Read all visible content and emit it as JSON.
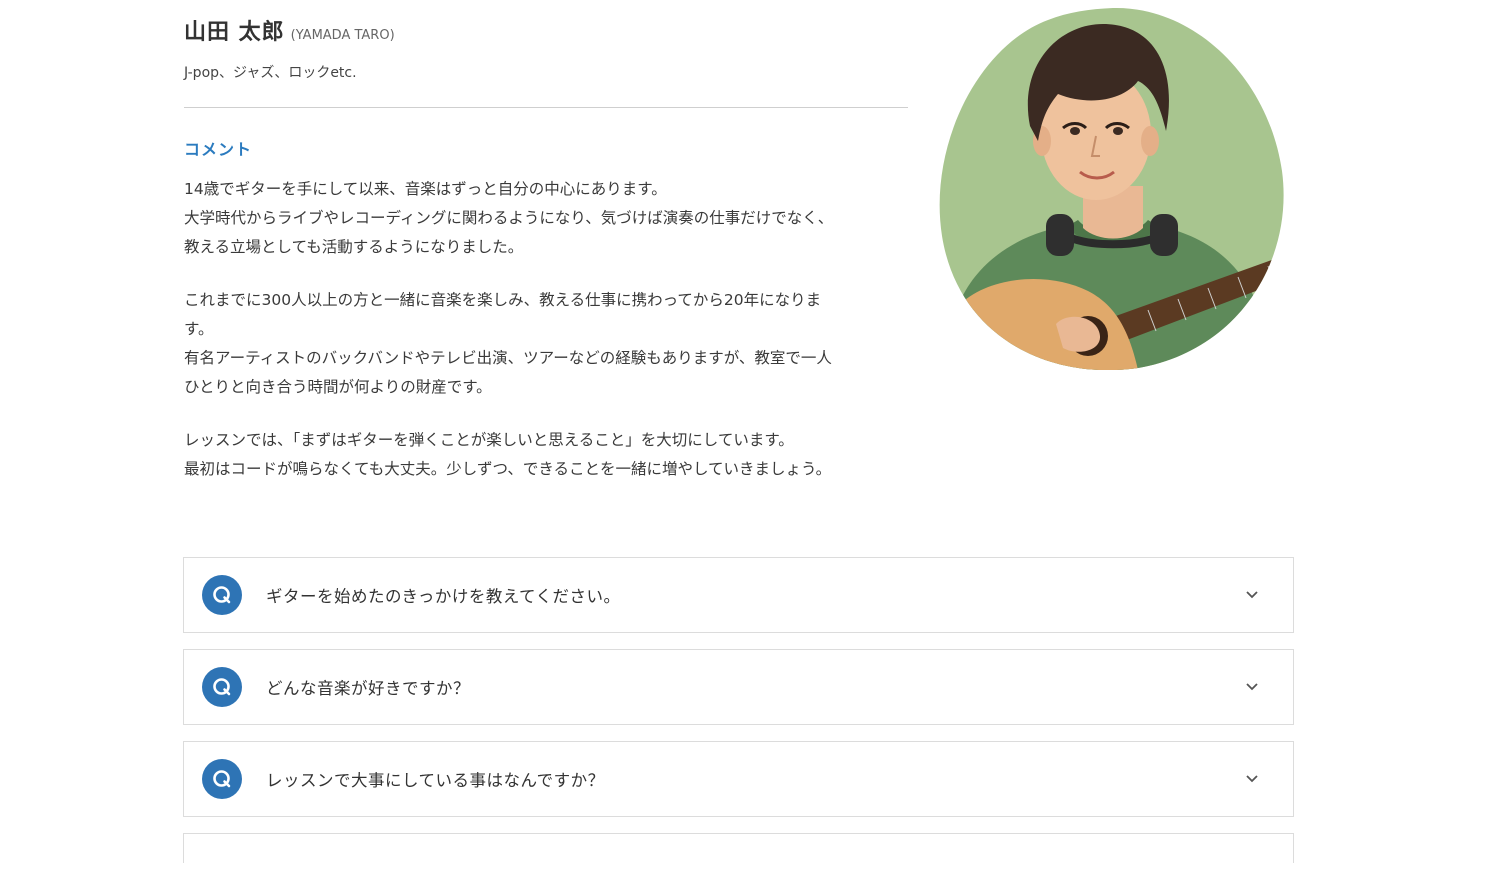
{
  "profile": {
    "name_jp": "山田 太郎",
    "name_en": "(YAMADA TARO)",
    "genres": "J-pop、ジャズ、ロックetc."
  },
  "comment": {
    "heading": "コメント",
    "paragraphs": [
      [
        "14歳でギターを手にして以来、音楽はずっと自分の中心にあります。",
        "大学時代からライブやレコーディングに関わるようになり、気づけば演奏の仕事だけでなく、",
        "教える立場としても活動するようになりました。"
      ],
      [
        "これまでに300人以上の方と一緒に音楽を楽しみ、教える仕事に携わってから20年になりま",
        "す。",
        "有名アーティストのバックバンドやテレビ出演、ツアーなどの経験もありますが、教室で一人",
        "ひとりと向き合う時間が何よりの財産です。"
      ],
      [
        "レッスンでは、「まずはギターを弾くことが楽しいと思えること」を大切にしています。",
        "最初はコードが鳴らなくても大丈夫。少しずつ、できることを一緒に増やしていきましょう。"
      ]
    ]
  },
  "faq": {
    "items": [
      {
        "q_mark": "Q",
        "question": "ギターを始めたのきっかけを教えてください。",
        "icon": "chevron-down-icon"
      },
      {
        "q_mark": "Q",
        "question": "どんな音楽が好きですか？",
        "icon": "chevron-down-icon"
      },
      {
        "q_mark": "Q",
        "question": "レッスンで大事にしている事はなんですか？",
        "icon": "chevron-down-icon"
      }
    ]
  },
  "colors": {
    "accent": "#2e74b5",
    "heading_blue": "#2b7bbf",
    "portrait_bg": "#a8c58f",
    "border": "#dcdcdc"
  }
}
